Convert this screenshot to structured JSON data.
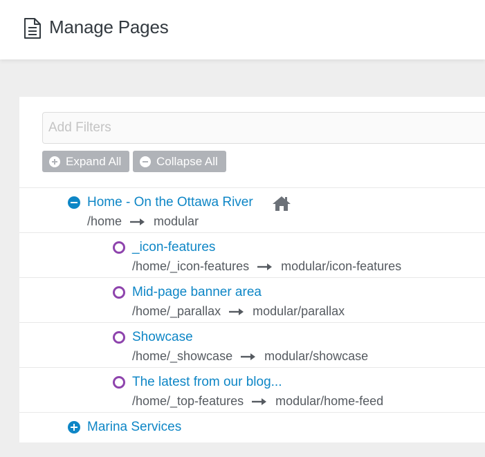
{
  "header": {
    "title": "Manage Pages",
    "icon": "document-icon"
  },
  "filters": {
    "placeholder": "Add Filters",
    "value": ""
  },
  "buttons": {
    "expand_label": "Expand All",
    "collapse_label": "Collapse All"
  },
  "pages": [
    {
      "title": "Home - On the Ottawa River",
      "route": "/home",
      "template": "modular",
      "level": 0,
      "state": "expanded",
      "is_home": true
    },
    {
      "title": "_icon-features",
      "route": "/home/_icon-features",
      "template": "modular/icon-features",
      "level": 1,
      "state": "leaf"
    },
    {
      "title": "Mid-page banner area",
      "route": "/home/_parallax",
      "template": "modular/parallax",
      "level": 1,
      "state": "leaf"
    },
    {
      "title": "Showcase",
      "route": "/home/_showcase",
      "template": "modular/showcase",
      "level": 1,
      "state": "leaf"
    },
    {
      "title": "The latest from our blog...",
      "route": "/home/_top-features",
      "template": "modular/home-feed",
      "level": 1,
      "state": "leaf"
    },
    {
      "title": "Marina Services",
      "route": "",
      "template": "",
      "level": 0,
      "state": "collapsed"
    }
  ],
  "colors": {
    "link": "#0e86c6",
    "leaf_ring": "#8e44ad",
    "button_bg": "#b0b3b8"
  }
}
